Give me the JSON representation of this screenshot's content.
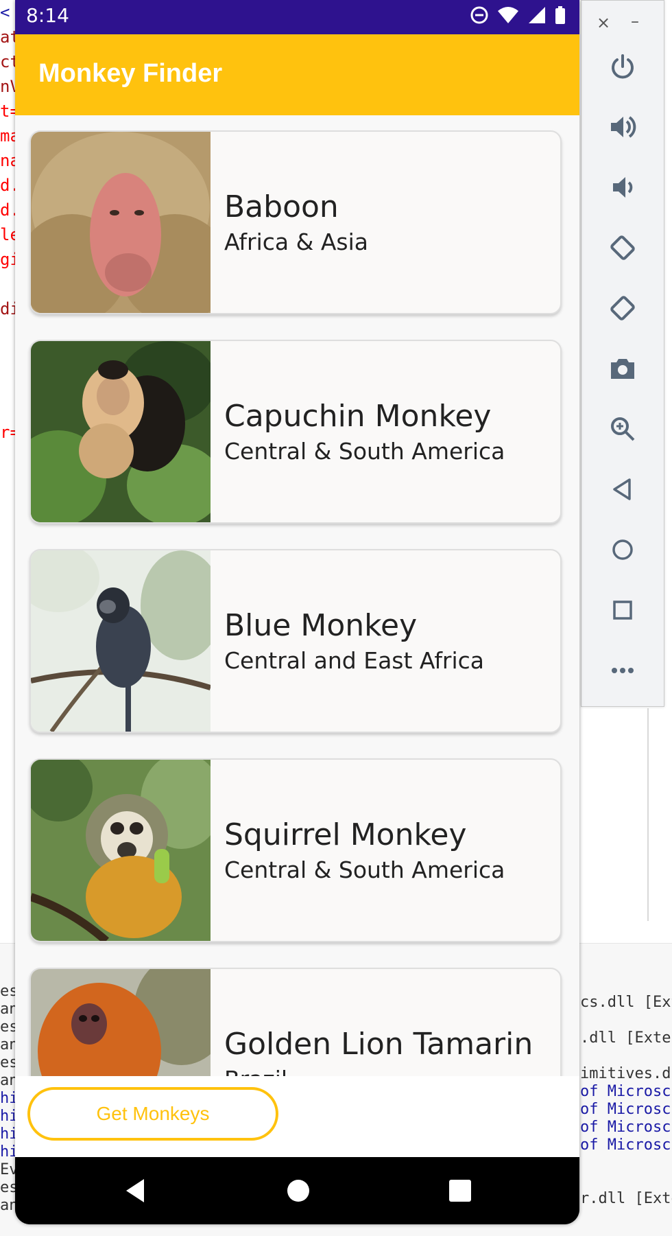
{
  "ide": {
    "left_lines": [
      {
        "text": "<",
        "color": "#1a1aa6"
      },
      {
        "text": "at",
        "color": "#a31515"
      },
      {
        "text": "ct",
        "color": "#a31515"
      },
      {
        "text": "nV",
        "color": "#a31515"
      },
      {
        "text": "t=",
        "color": "#ff0000"
      },
      {
        "text": "ma",
        "color": "#ff0000"
      },
      {
        "text": "na",
        "color": "#ff0000"
      },
      {
        "text": "d.",
        "color": "#ff0000"
      },
      {
        "text": "d.",
        "color": "#ff0000"
      },
      {
        "text": "le",
        "color": "#ff0000"
      },
      {
        "text": "gi",
        "color": "#ff0000"
      },
      {
        "text": "",
        "color": "#000000"
      },
      {
        "text": "di",
        "color": "#a31515"
      },
      {
        "text": "",
        "color": "#000000"
      },
      {
        "text": "",
        "color": "#000000"
      },
      {
        "text": "",
        "color": "#000000"
      },
      {
        "text": "",
        "color": "#000000"
      },
      {
        "text": "r=",
        "color": "#ff0000"
      }
    ],
    "left_bottom_lines": [
      "es",
      "an",
      "es",
      "an",
      "es",
      "an",
      "hi",
      "hi",
      "hi",
      "hi",
      "Ev",
      "es",
      "an"
    ],
    "right_lines": [
      "cs.dll [Ext",
      "",
      ".dll [Exter",
      "",
      "imitives.dl",
      "of Microsc",
      "of Microsc",
      "of Microsc",
      "of Microsc",
      "",
      "",
      "r.dll [Exte"
    ]
  },
  "emulator": {
    "close": "×",
    "minimize": "–",
    "buttons": [
      "power-icon",
      "volume-up-icon",
      "volume-down-icon",
      "rotate-left-icon",
      "rotate-right-icon",
      "camera-icon",
      "zoom-icon",
      "back-icon",
      "home-icon",
      "overview-icon",
      "more-icon"
    ]
  },
  "status": {
    "time": "8:14"
  },
  "app": {
    "title": "Monkey Finder"
  },
  "monkeys": [
    {
      "name": "Baboon",
      "location": "Africa & Asia"
    },
    {
      "name": "Capuchin Monkey",
      "location": "Central & South America"
    },
    {
      "name": "Blue Monkey",
      "location": "Central and East Africa"
    },
    {
      "name": "Squirrel Monkey",
      "location": "Central & South America"
    },
    {
      "name": "Golden Lion Tamarin",
      "location": "Brazil"
    }
  ],
  "actions": {
    "get_monkeys": "Get Monkeys"
  },
  "colors": {
    "status_bar": "#2e128e",
    "accent": "#ffc20e"
  }
}
